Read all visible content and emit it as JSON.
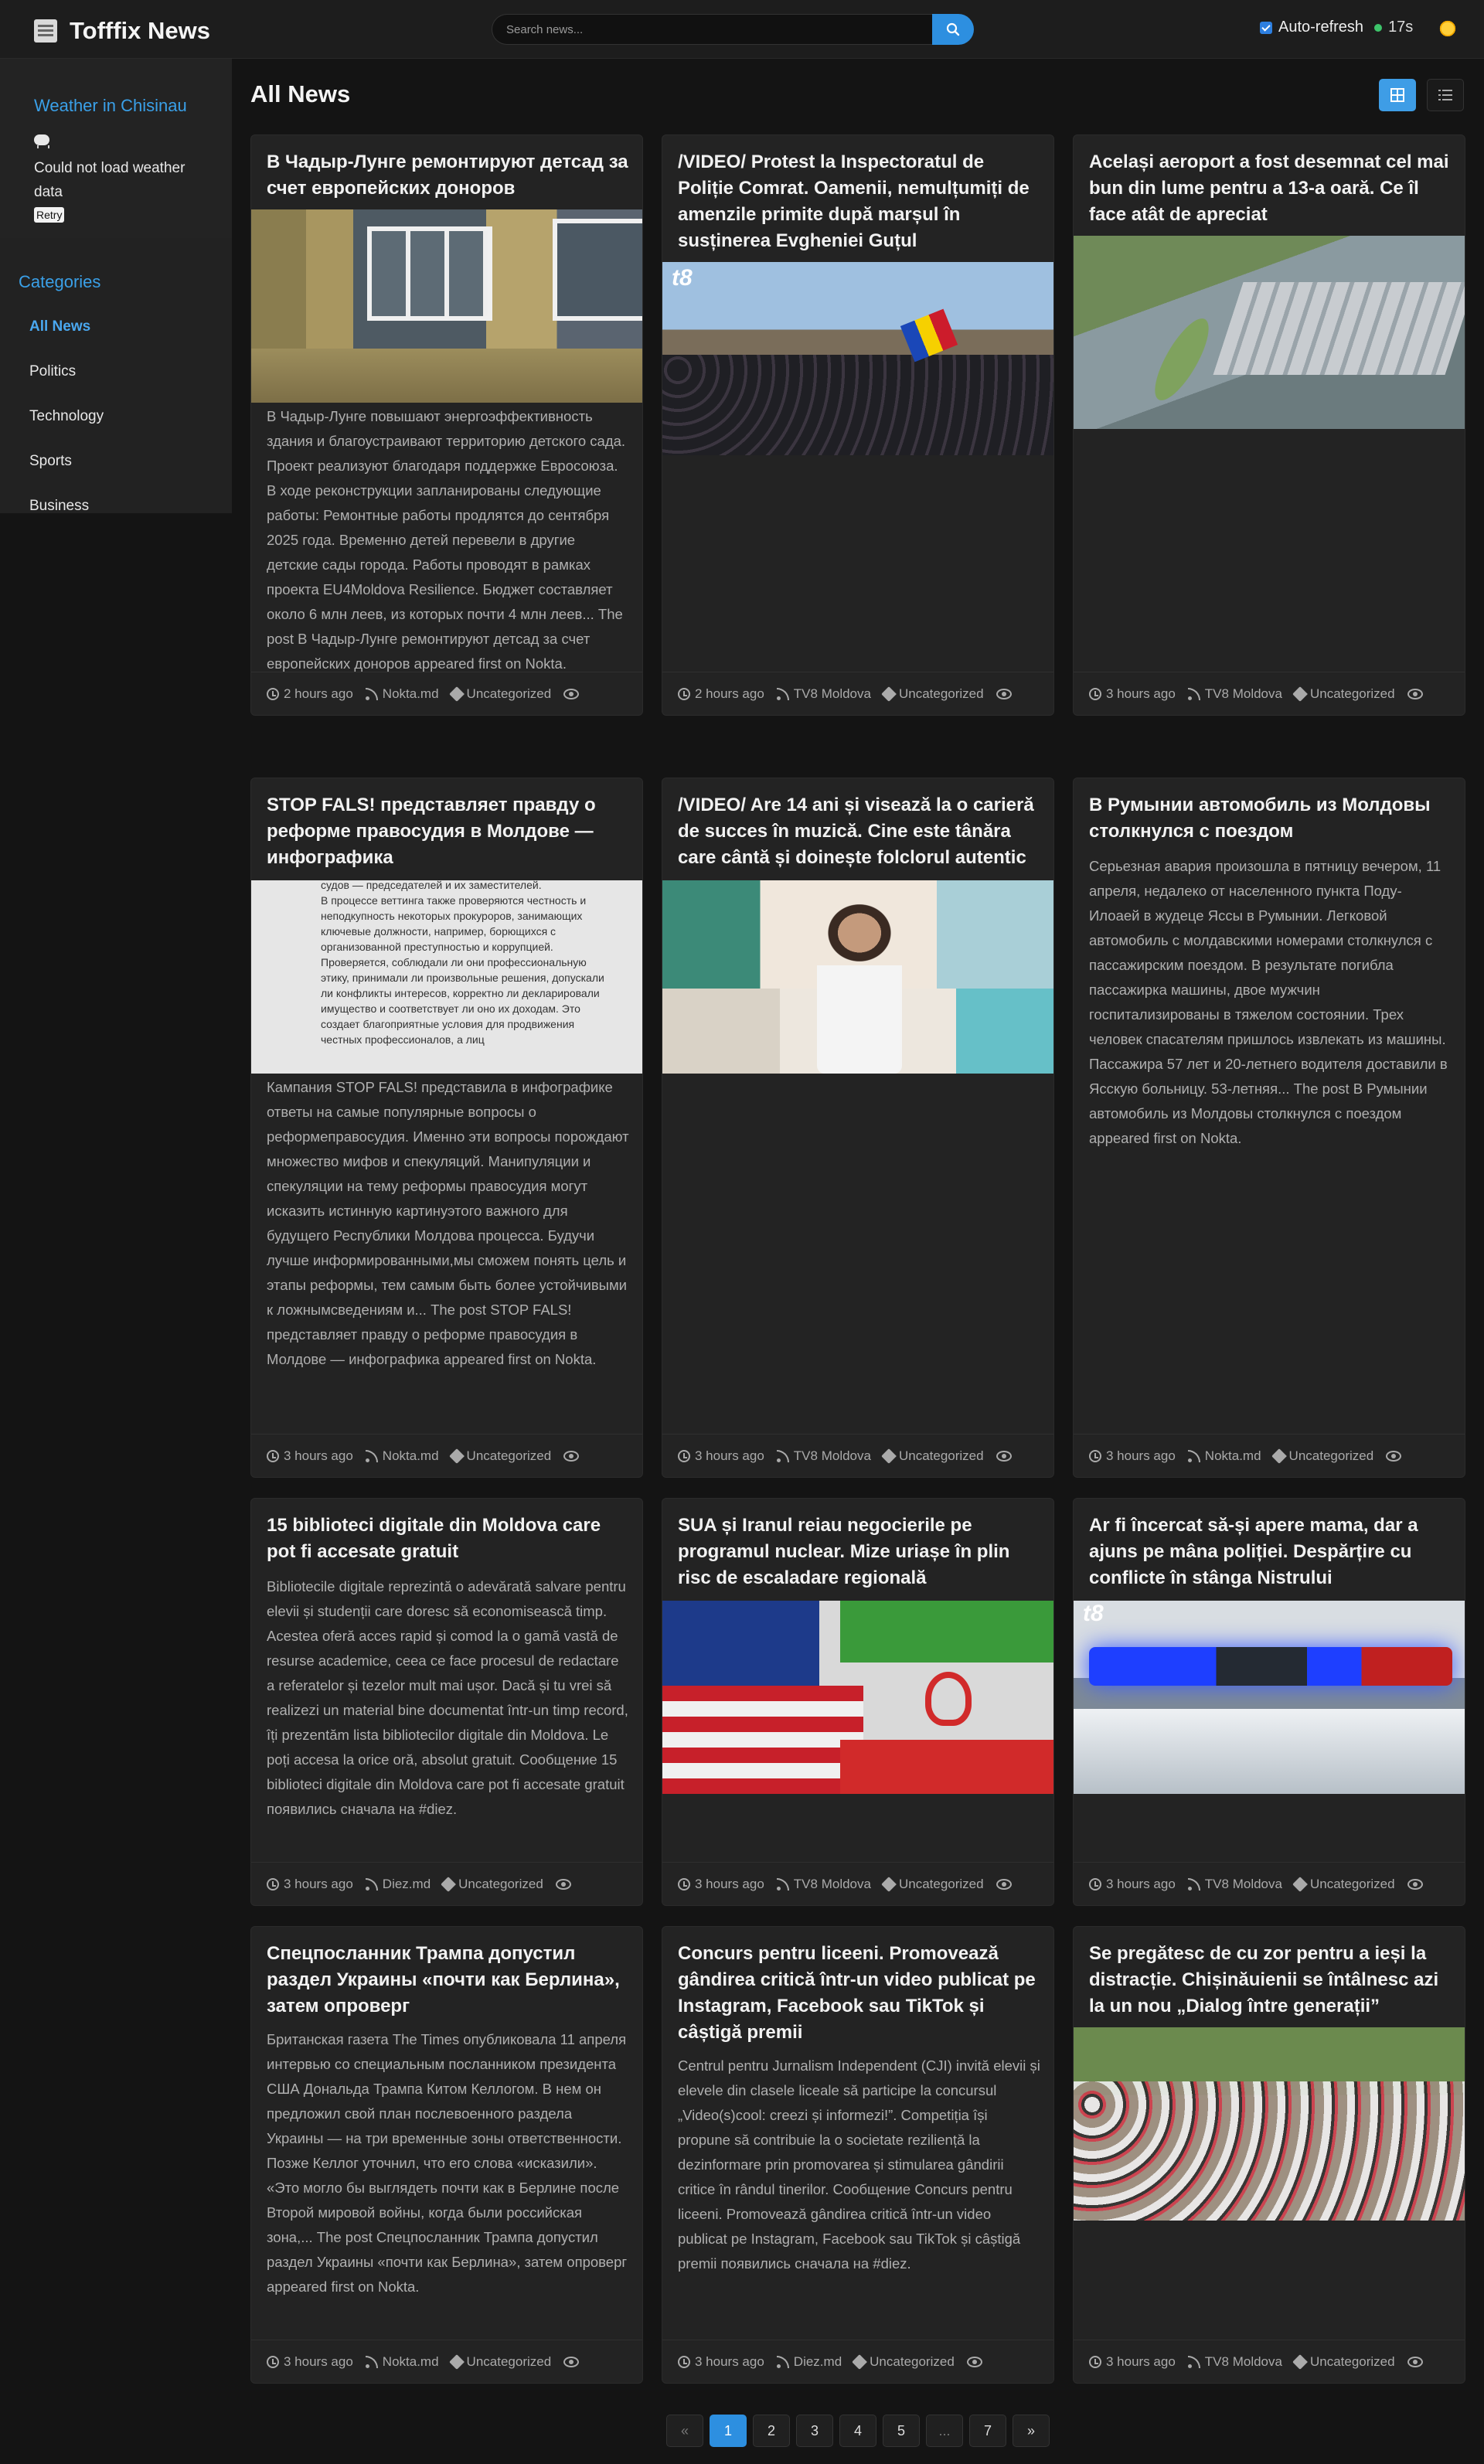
{
  "header": {
    "title": "Tofffix News",
    "search_placeholder": "Search news...",
    "auto_refresh_label": "Auto-refresh",
    "auto_refresh_checked": true,
    "countdown": "17s",
    "colors": {
      "accent": "#2d8fe0",
      "background": "#141414",
      "status_dot": "#3dc46a"
    }
  },
  "sidebar": {
    "weather_title": "Weather in Chisinau",
    "weather_error": "Could not load weather data",
    "retry_label": "Retry",
    "categories_title": "Categories",
    "categories": [
      "All News",
      "Politics",
      "Technology",
      "Sports",
      "Business"
    ],
    "active_category": "All News"
  },
  "main": {
    "title": "All News",
    "view_modes": [
      "grid-icon",
      "list-icon"
    ],
    "active_view": "grid-icon"
  },
  "articles": [
    {
      "title": "В Чадыр-Лунге ремонтируют детсад за счет европейских доноров",
      "image": "building-renovation",
      "description": "В Чадыр-Лунге повышают энергоэффективность здания и благоустраивают территорию детского сада. Проект реализуют благодаря поддержке Евросоюза.   В ходе реконструкции запланированы следующие работы: Ремонтные работы продлятся до сентября 2025 года. Временно детей перевели в другие детские сады города. Работы проводят в рамках проекта EU4Moldova Resilience. Бюджет составляет около 6 млн леев, из которых почти 4 млн леев... The post В Чадыр-Лунге ремонтируют детсад за счет европейских доноров appeared first on Nokta.",
      "time": "2 hours ago",
      "source": "Nokta.md",
      "category": "Uncategorized"
    },
    {
      "title": "/VIDEO/ Protest la Inspectoratul de Poliție Comrat. Oamenii, nemulțumiți de amenzile primite după marșul în susținerea Evgheniei Guțul",
      "image": "protest-crowd",
      "image_logo": "t8",
      "description": "",
      "time": "2 hours ago",
      "source": "TV8 Moldova",
      "category": "Uncategorized"
    },
    {
      "title": "Același aeroport a fost desemnat cel mai bun din lume pentru a 13-a oară. Ce îl face atât de apreciat",
      "image": "airport-aerial",
      "description": "",
      "time": "3 hours ago",
      "source": "TV8 Moldova",
      "category": "Uncategorized"
    },
    {
      "title": "STOP FALS! представляет правду о реформе правосудия в Молдове — инфографика",
      "image": "infographic-text",
      "image_text": "судов — председателей и их заместителей.\nВ процессе веттинга также проверяются честность и неподкупность некоторых прокуроров, занимающих ключевые должности, например, борющихся с организованной преступностью и коррупцией. Проверяется, соблюдали ли они профессиональную этику, принимали ли произвольные решения, допускали ли конфликты интересов, корректно ли декларировали имущество и соответствует ли оно их доходам. Это создает благоприятные условия для продвижения честных профессионалов, а лиц",
      "description": "Кампания STOP FALS! представила в инфографике ответы на самые популярные вопросы о реформеправосудия. Именно эти вопросы порождают множество мифов и спекуляций. Манипуляции и спекуляции на тему реформы правосудия могут исказить истинную картинуэтого важного для будущего Республики Молдова процесса. Будучи лучше информированными,мы сможем понять цель и этапы реформы, тем самым быть более устойчивыми к ложнымсведениям и... The post STOP FALS! представляет правду о реформе правосудия в Молдове — инфографика appeared first on Nokta.",
      "time": "3 hours ago",
      "source": "Nokta.md",
      "category": "Uncategorized"
    },
    {
      "title": "/VIDEO/ Are 14 ani și visează la o carieră de succes în muzică. Cine este tânăra care cântă și doinește folclorul autentic",
      "image": "girl-folk-costume",
      "description": "",
      "time": "3 hours ago",
      "source": "TV8 Moldova",
      "category": "Uncategorized"
    },
    {
      "title": "В Румынии автомобиль из Молдовы столкнулся с поездом",
      "image": "",
      "description": "Серьезная авария произошла в пятницу вечером, 11 апреля, недалеко от населенного пункта Поду-Илоаей в жудеце Яссы в Румынии. Легковой автомобиль с молдавскими номерами столкнулся с пассажирским поездом. В результате погибла пассажирка машины, двое мужчин госпитализированы в тяжелом состоянии. Трех человек спасателям пришлось извлекать из машины. Пассажира 57 лет и 20-летнего водителя доставили в Ясскую больницу. 53-летняя... The post В Румынии автомобиль из Молдовы столкнулся с поездом  appeared first on Nokta.",
      "time": "3 hours ago",
      "source": "Nokta.md",
      "category": "Uncategorized"
    },
    {
      "title": "15 biblioteci digitale din Moldova care pot fi accesate gratuit",
      "image": "",
      "description": "Bibliotecile digitale reprezintă o adevărată salvare pentru elevii și studenții care doresc să economisească timp. Acestea oferă acces rapid și comod la o gamă vastă de resurse academice, ceea ce face procesul de redactare a referatelor și tezelor mult mai ușor. Dacă și tu vrei să realizezi un material bine documentat într-un timp record, îți prezentăm lista bibliotecilor digitale din Moldova. Le poți accesa la orice oră, absolut gratuit. Сообщение 15 biblioteci digitale din Moldova care pot fi accesate gratuit появились сначала на #diez.",
      "time": "3 hours ago",
      "source": "Diez.md",
      "category": "Uncategorized"
    },
    {
      "title": "SUA și Iranul reiau negocierile pe programul nuclear. Mize uriașe în plin risc de escaladare regională",
      "image": "usa-iran-flags",
      "description": "",
      "time": "3 hours ago",
      "source": "TV8 Moldova",
      "category": "Uncategorized"
    },
    {
      "title": "Ar fi încercat să-și apere mama, dar a ajuns pe mâna poliției. Despărțire cu conflicte în stânga Nistrului",
      "image": "police-lights",
      "image_logo": "t8",
      "description": "",
      "time": "3 hours ago",
      "source": "TV8 Moldova",
      "category": "Uncategorized"
    },
    {
      "title": "Спецпосланник Трампа допустил раздел Украины «почти как Берлина», затем опроверг",
      "image": "",
      "description": "Британская газета The Times опубликовала 11 апреля интервью со специальным посланником президента США Дональда Трампа Китом Келлогом. В нем он предложил свой план послевоенного раздела Украины — на три временные зоны ответственности. Позже Келлог уточнил, что его слова «исказили».  «Это могло бы выглядеть почти как в Берлине после Второй мировой войны, когда были российская зона,... The post Спецпосланник Трампа допустил раздел Украины «почти как Берлина», затем опроверг appeared first on Nokta.",
      "time": "3 hours ago",
      "source": "Nokta.md",
      "category": "Uncategorized"
    },
    {
      "title": "Concurs pentru liceeni. Promovează gândirea critică într-un video publicat pe Instagram, Facebook sau TikTok și câștigă premii",
      "image": "",
      "description": "Centrul pentru Jurnalism Independent (CJI) invită elevii și elevele din clasele liceale să participe la concursul „Video(s)cool: creezi și informezi!”. Competiția își propune să contribuie la o societate reziliență la dezinformare prin promovarea și stimularea gândirii critice în rândul tinerilor. Сообщение Concurs pentru liceeni. Promovează gândirea critică într-un video publicat pe Instagram, Facebook sau TikTok și câștigă premii появились сначала на #diez.",
      "time": "3 hours ago",
      "source": "Diez.md",
      "category": "Uncategorized"
    },
    {
      "title": "Se pregătesc de cu zor pentru a ieși la distracție. Chișinăuienii se întâlnesc azi la un nou „Dialog între generații”",
      "image": "park-dancing",
      "description": "",
      "time": "3 hours ago",
      "source": "TV8 Moldova",
      "category": "Uncategorized"
    }
  ],
  "pagination": {
    "prev": "«",
    "pages": [
      "1",
      "2",
      "3",
      "4",
      "5",
      "...",
      "7"
    ],
    "current": "1",
    "next": "»"
  }
}
